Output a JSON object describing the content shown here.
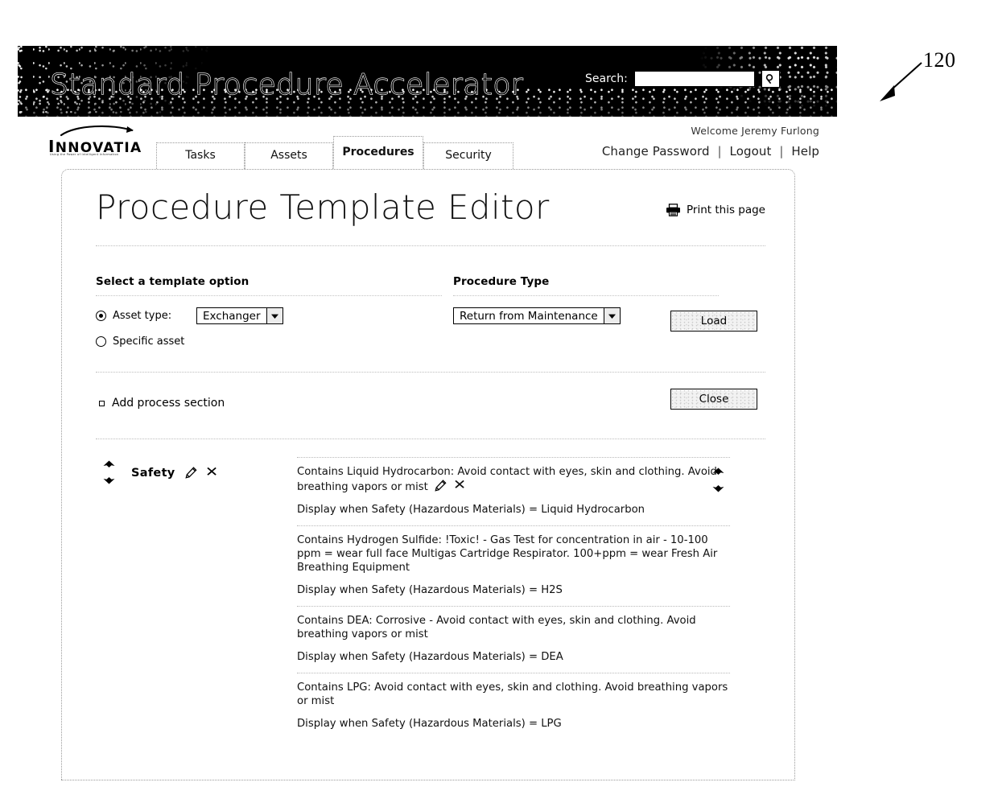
{
  "callout": {
    "number": "120"
  },
  "banner": {
    "title": "Standard Procedure Accelerator",
    "search_label": "Search:",
    "search_value": "",
    "search_placeholder": "",
    "search_button_icon": "search-icon"
  },
  "logo": {
    "wordmark_first": "I",
    "wordmark_rest": "NNOVATIA",
    "tagline": "Using the Power of Intelligent Information"
  },
  "tabs": [
    {
      "label": "Tasks",
      "active": false
    },
    {
      "label": "Assets",
      "active": false
    },
    {
      "label": "Procedures",
      "active": true
    },
    {
      "label": "Security",
      "active": false
    }
  ],
  "user": {
    "welcome": "Welcome Jeremy Furlong",
    "links": [
      "Change Password",
      "Logout",
      "Help"
    ],
    "separator": "|"
  },
  "page": {
    "title": "Procedure Template Editor",
    "print_label": "Print this page"
  },
  "form": {
    "left_heading": "Select a template option",
    "right_heading": "Procedure Type",
    "radio_asset_type": "Asset type:",
    "radio_specific_asset": "Specific asset",
    "asset_type_value": "Exchanger",
    "procedure_type_value": "Return from Maintenance",
    "load_button": "Load",
    "close_button": "Close",
    "add_section_label": "Add process section"
  },
  "section": {
    "title": "Safety",
    "blocks": [
      {
        "text": "Contains Liquid Hydrocarbon: Avoid contact with eyes, skin and clothing. Avoid breathing vapors or mist",
        "display_rule": "Display when Safety (Hazardous Materials) = Liquid Hydrocarbon",
        "has_inline_icons": true
      },
      {
        "text": "Contains Hydrogen Sulfide: !Toxic! - Gas Test for concentration in air - 10-100 ppm = wear full face Multigas Cartridge Respirator. 100+ppm = wear Fresh Air Breathing Equipment",
        "display_rule": "Display when Safety (Hazardous Materials) = H2S",
        "has_inline_icons": false
      },
      {
        "text": "Contains DEA: Corrosive - Avoid contact with eyes, skin and clothing. Avoid breathing vapors or mist",
        "display_rule": "Display when Safety (Hazardous Materials) = DEA",
        "has_inline_icons": false
      },
      {
        "text": "Contains LPG: Avoid contact with eyes, skin and clothing. Avoid breathing vapors or mist",
        "display_rule": "Display when Safety (Hazardous Materials) = LPG",
        "has_inline_icons": false
      }
    ]
  },
  "colors": {
    "page_bg": "#ffffff",
    "banner_bg": "#000000",
    "text": "#111111",
    "rule": "#bdbdbd"
  }
}
